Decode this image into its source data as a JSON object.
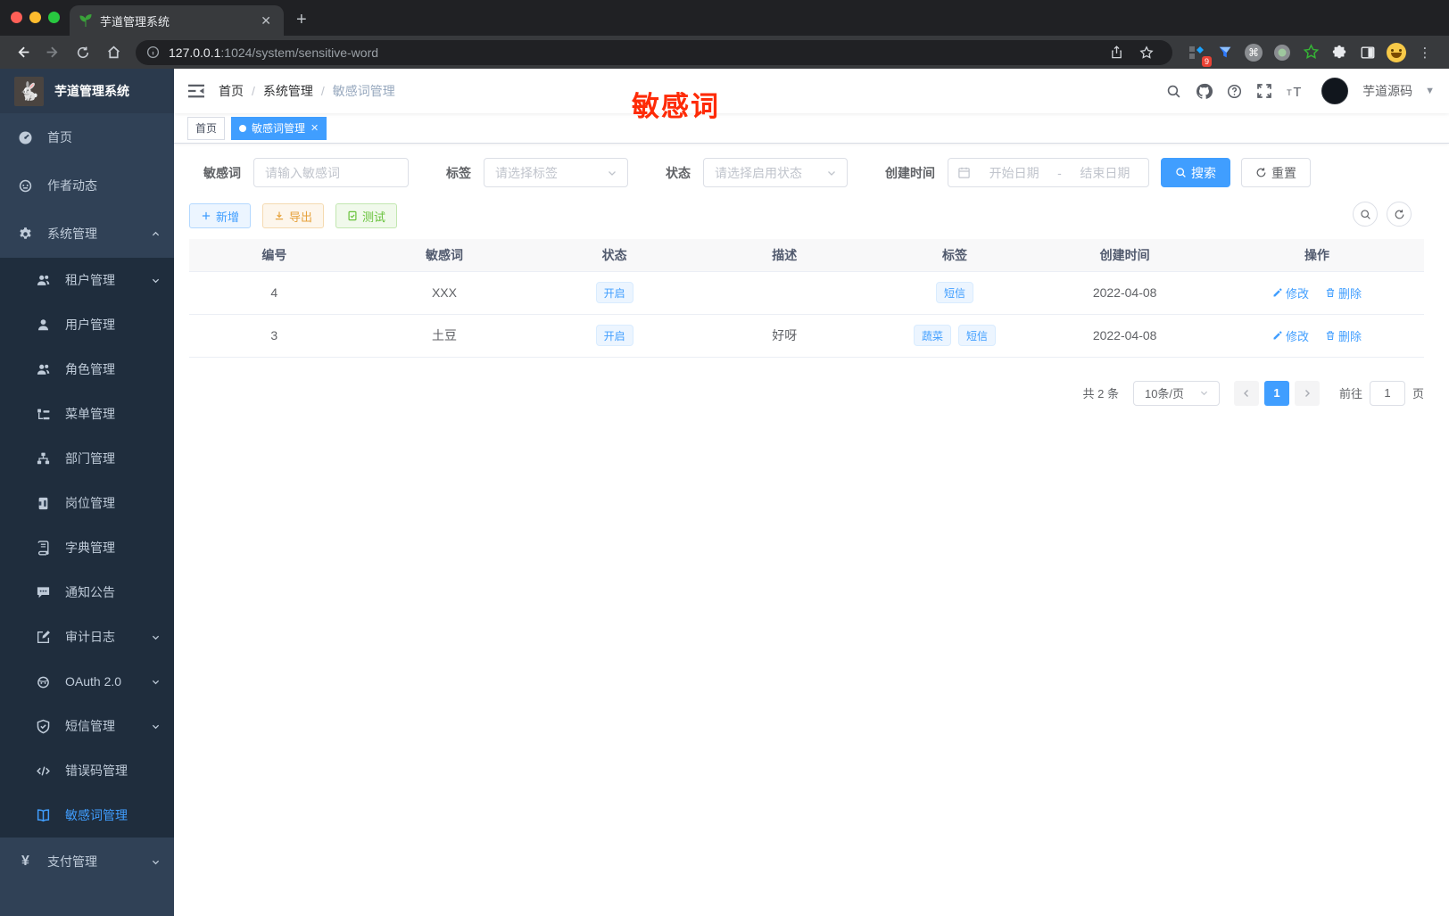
{
  "browser": {
    "tab_title": "芋道管理系统",
    "url_host": "127.0.0.1",
    "url_rest": ":1024/system/sensitive-word",
    "ext_badge": "9"
  },
  "sidebar": {
    "title": "芋道管理系统",
    "items": [
      {
        "label": "首页"
      },
      {
        "label": "作者动态"
      },
      {
        "label": "系统管理"
      },
      {
        "label": "租户管理"
      },
      {
        "label": "用户管理"
      },
      {
        "label": "角色管理"
      },
      {
        "label": "菜单管理"
      },
      {
        "label": "部门管理"
      },
      {
        "label": "岗位管理"
      },
      {
        "label": "字典管理"
      },
      {
        "label": "通知公告"
      },
      {
        "label": "审计日志"
      },
      {
        "label": "OAuth 2.0"
      },
      {
        "label": "短信管理"
      },
      {
        "label": "错误码管理"
      },
      {
        "label": "敏感词管理"
      },
      {
        "label": "支付管理"
      }
    ]
  },
  "navbar": {
    "breadcrumb": [
      {
        "label": "首页"
      },
      {
        "label": "系统管理"
      },
      {
        "label": "敏感词管理"
      }
    ],
    "separator": "/",
    "annotation": "敏感词",
    "username": "芋道源码"
  },
  "tags_view": {
    "tabs": [
      {
        "label": "首页"
      },
      {
        "label": "敏感词管理"
      }
    ]
  },
  "filters": {
    "keyword_label": "敏感词",
    "keyword_placeholder": "请输入敏感词",
    "tag_label": "标签",
    "tag_placeholder": "请选择标签",
    "status_label": "状态",
    "status_placeholder": "请选择启用状态",
    "date_label": "创建时间",
    "date_start_placeholder": "开始日期",
    "date_separator": "-",
    "date_end_placeholder": "结束日期",
    "search_label": "搜索",
    "reset_label": "重置"
  },
  "toolbar": {
    "add_label": "新增",
    "export_label": "导出",
    "test_label": "测试"
  },
  "table": {
    "columns": [
      "编号",
      "敏感词",
      "状态",
      "描述",
      "标签",
      "创建时间",
      "操作"
    ],
    "rows": [
      {
        "id": "4",
        "word": "XXX",
        "status": "开启",
        "description": "",
        "tags": [
          "短信"
        ],
        "created": "2022-04-08"
      },
      {
        "id": "3",
        "word": "土豆",
        "status": "开启",
        "description": "好呀",
        "tags": [
          "蔬菜",
          "短信"
        ],
        "created": "2022-04-08"
      }
    ],
    "actions": {
      "edit": "修改",
      "delete": "删除"
    }
  },
  "pagination": {
    "total": "共 2 条",
    "page_size": "10条/页",
    "current_page": "1",
    "goto_label": "前往",
    "goto_value": "1",
    "page_unit": "页"
  },
  "colors": {
    "accent": "#409eff",
    "sidebar_bg": "#304156",
    "submenu_bg": "#1f2d3d",
    "annotation_red": "#fe2b07",
    "warning": "#e6a23c",
    "success": "#67c23a"
  }
}
